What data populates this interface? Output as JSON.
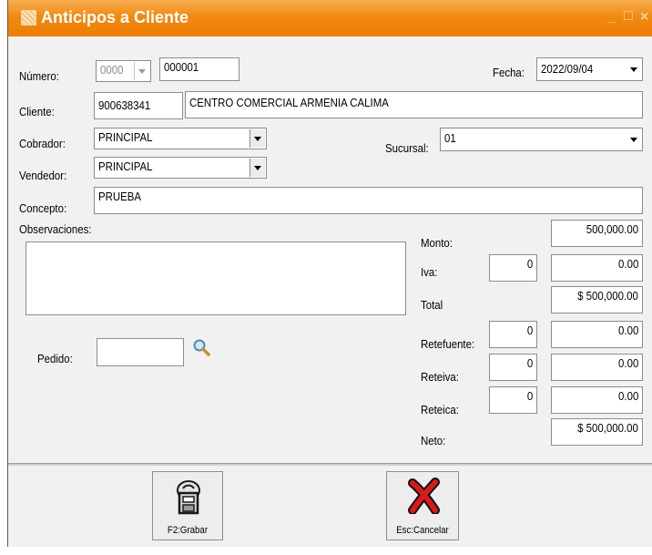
{
  "window": {
    "title": "Anticipos a Cliente"
  },
  "form": {
    "numero": {
      "label": "Número:",
      "prefix": "0000",
      "value": "000001"
    },
    "fecha": {
      "label": "Fecha:",
      "value": "2022/09/04"
    },
    "cliente": {
      "label": "Cliente:",
      "nit": "900638341",
      "nombre": "CENTRO COMERCIAL ARMENIA CALIMA"
    },
    "cobrador": {
      "label": "Cobrador:",
      "value": "PRINCIPAL"
    },
    "sucursal": {
      "label": "Sucursal:",
      "value": "01"
    },
    "vendedor": {
      "label": "Vendedor:",
      "value": "PRINCIPAL"
    },
    "concepto": {
      "label": "Concepto:",
      "value": "PRUEBA"
    },
    "observaciones": {
      "label": "Observaciones:",
      "value": ""
    },
    "pedido": {
      "label": "Pedido:",
      "value": ""
    }
  },
  "totals": {
    "monto": {
      "label": "Monto:",
      "value": "500,000.00"
    },
    "iva": {
      "label": "Iva:",
      "percent": "0",
      "value": "0.00"
    },
    "total": {
      "label": "Total",
      "value": "$ 500,000.00"
    },
    "retefuente": {
      "label": "Retefuente:",
      "percent": "0",
      "value": "0.00"
    },
    "reteiva": {
      "label": "Reteiva:",
      "percent": "0",
      "value": "0.00"
    },
    "reteica": {
      "label": "Reteica:",
      "percent": "0",
      "value": "0.00"
    },
    "neto": {
      "label": "Neto:",
      "value": "$ 500,000.00"
    }
  },
  "buttons": {
    "grabar": "F2:Grabar",
    "cancelar": "Esc:Cancelar"
  },
  "colors": {
    "titlebar": "#f08a12",
    "cancel_x": "#d81a1a"
  },
  "icons": [
    "window-app-icon",
    "minimize-icon",
    "maximize-icon",
    "close-icon",
    "search-icon",
    "save-icon",
    "cancel-x-icon"
  ]
}
